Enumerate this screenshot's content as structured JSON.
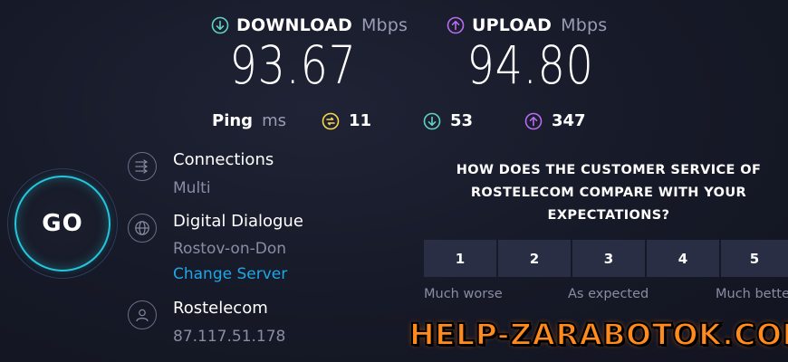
{
  "download": {
    "label": "DOWNLOAD",
    "unit": "Mbps",
    "value": "93.67",
    "color": "#5fd3c3"
  },
  "upload": {
    "label": "UPLOAD",
    "unit": "Mbps",
    "value": "94.80",
    "color": "#b86cf0"
  },
  "ping": {
    "label": "Ping",
    "unit": "ms",
    "idle": "11",
    "download": "53",
    "upload": "347",
    "idle_color": "#f6d84a"
  },
  "go_button": {
    "label": "GO",
    "ring_color": "#24c6dc"
  },
  "connections": {
    "title": "Connections",
    "value": "Multi"
  },
  "server": {
    "name": "Digital Dialogue",
    "location": "Rostov-on-Don",
    "change_link": "Change Server"
  },
  "provider": {
    "name": "Rostelecom",
    "ip": "87.117.51.178"
  },
  "survey": {
    "question": "HOW DOES THE CUSTOMER SERVICE OF ROSTELECOM COMPARE WITH YOUR EXPECTATIONS?",
    "options": [
      "1",
      "2",
      "3",
      "4",
      "5"
    ],
    "scale_labels": {
      "low": "Much worse",
      "mid": "As expected",
      "high": "Much better"
    }
  },
  "watermark": {
    "text": "HELP-ZARABOTOK.COM"
  }
}
